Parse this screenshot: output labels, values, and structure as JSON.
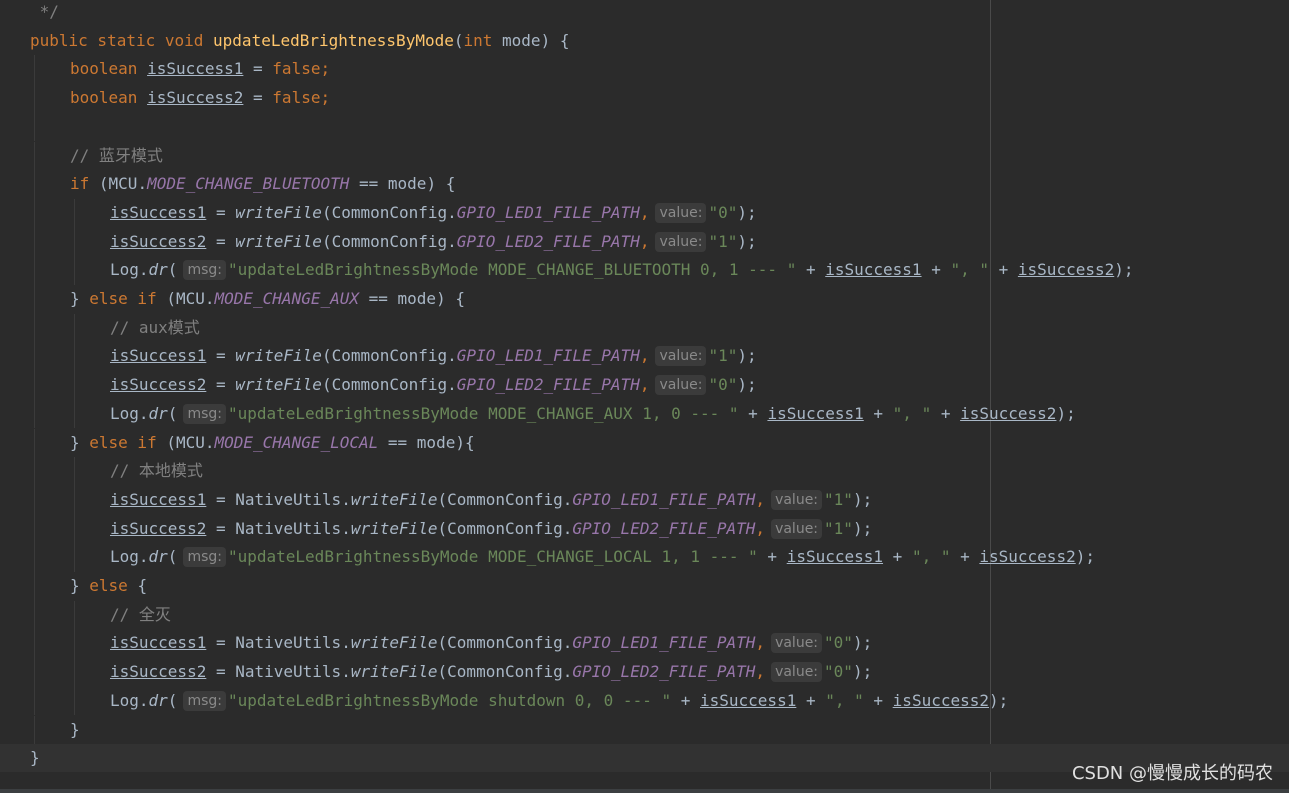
{
  "colors": {
    "background": "#2b2b2b",
    "keyword": "#cc7832",
    "method_declaration": "#ffc66d",
    "static_field": "#9876aa",
    "string": "#6a8759",
    "comment": "#808080",
    "default_text": "#a9b7c6",
    "inlay_hint_bg": "#3b3b3b"
  },
  "watermark": "CSDN @慢慢成长的码农",
  "code_lines": [
    {
      "indent": 0,
      "tokens": [
        {
          "t": " */",
          "c": "cmt"
        }
      ]
    },
    {
      "indent": 0,
      "tokens": [
        {
          "t": "public static void ",
          "c": "kw"
        },
        {
          "t": "updateLedBrightnessByMode",
          "c": "fn"
        },
        {
          "t": "(",
          "c": "t"
        },
        {
          "t": "int ",
          "c": "kw"
        },
        {
          "t": "mode) {",
          "c": "t"
        }
      ]
    },
    {
      "indent": 1,
      "tokens": [
        {
          "t": "boolean ",
          "c": "kw"
        },
        {
          "t": "isSuccess1",
          "c": "u"
        },
        {
          "t": " = ",
          "c": "t"
        },
        {
          "t": "false;",
          "c": "kw"
        }
      ]
    },
    {
      "indent": 1,
      "tokens": [
        {
          "t": "boolean ",
          "c": "kw"
        },
        {
          "t": "isSuccess2",
          "c": "u"
        },
        {
          "t": " = ",
          "c": "t"
        },
        {
          "t": "false;",
          "c": "kw"
        }
      ]
    },
    {
      "indent": 1,
      "tokens": []
    },
    {
      "indent": 1,
      "tokens": [
        {
          "t": "// 蓝牙模式",
          "c": "cmt"
        }
      ]
    },
    {
      "indent": 1,
      "tokens": [
        {
          "t": "if ",
          "c": "kw"
        },
        {
          "t": "(MCU.",
          "c": "t"
        },
        {
          "t": "MODE_CHANGE_BLUETOOTH",
          "c": "field"
        },
        {
          "t": " == mode) {",
          "c": "t"
        }
      ]
    },
    {
      "indent": 2,
      "tokens": [
        {
          "t": "isSuccess1",
          "c": "u"
        },
        {
          "t": " = ",
          "c": "t"
        },
        {
          "t": "writeFile",
          "c": "ital"
        },
        {
          "t": "(CommonConfig.",
          "c": "t"
        },
        {
          "t": "GPIO_LED1_FILE_PATH",
          "c": "field"
        },
        {
          "t": ",",
          "c": "kw"
        },
        {
          "t": "value:",
          "c": "hint"
        },
        {
          "t": "\"0\"",
          "c": "str"
        },
        {
          "t": ");",
          "c": "t"
        }
      ]
    },
    {
      "indent": 2,
      "tokens": [
        {
          "t": "isSuccess2",
          "c": "u"
        },
        {
          "t": " = ",
          "c": "t"
        },
        {
          "t": "writeFile",
          "c": "ital"
        },
        {
          "t": "(CommonConfig.",
          "c": "t"
        },
        {
          "t": "GPIO_LED2_FILE_PATH",
          "c": "field"
        },
        {
          "t": ",",
          "c": "kw"
        },
        {
          "t": "value:",
          "c": "hint"
        },
        {
          "t": "\"1\"",
          "c": "str"
        },
        {
          "t": ");",
          "c": "t"
        }
      ]
    },
    {
      "indent": 2,
      "tokens": [
        {
          "t": "Log.",
          "c": "t"
        },
        {
          "t": "dr",
          "c": "ital"
        },
        {
          "t": "(",
          "c": "t"
        },
        {
          "t": "msg:",
          "c": "hint"
        },
        {
          "t": "\"updateLedBrightnessByMode MODE_CHANGE_BLUETOOTH 0, 1 --- \"",
          "c": "str"
        },
        {
          "t": " + ",
          "c": "t"
        },
        {
          "t": "isSuccess1",
          "c": "u"
        },
        {
          "t": " + ",
          "c": "t"
        },
        {
          "t": "\", \"",
          "c": "str"
        },
        {
          "t": " + ",
          "c": "t"
        },
        {
          "t": "isSuccess2",
          "c": "u"
        },
        {
          "t": ");",
          "c": "t"
        }
      ]
    },
    {
      "indent": 1,
      "tokens": [
        {
          "t": "} ",
          "c": "t"
        },
        {
          "t": "else if ",
          "c": "kw"
        },
        {
          "t": "(MCU.",
          "c": "t"
        },
        {
          "t": "MODE_CHANGE_AUX",
          "c": "field"
        },
        {
          "t": " == mode) {",
          "c": "t"
        }
      ]
    },
    {
      "indent": 2,
      "tokens": [
        {
          "t": "// aux模式",
          "c": "cmt"
        }
      ]
    },
    {
      "indent": 2,
      "tokens": [
        {
          "t": "isSuccess1",
          "c": "u"
        },
        {
          "t": " = ",
          "c": "t"
        },
        {
          "t": "writeFile",
          "c": "ital"
        },
        {
          "t": "(CommonConfig.",
          "c": "t"
        },
        {
          "t": "GPIO_LED1_FILE_PATH",
          "c": "field"
        },
        {
          "t": ",",
          "c": "kw"
        },
        {
          "t": "value:",
          "c": "hint"
        },
        {
          "t": "\"1\"",
          "c": "str"
        },
        {
          "t": ");",
          "c": "t"
        }
      ]
    },
    {
      "indent": 2,
      "tokens": [
        {
          "t": "isSuccess2",
          "c": "u"
        },
        {
          "t": " = ",
          "c": "t"
        },
        {
          "t": "writeFile",
          "c": "ital"
        },
        {
          "t": "(CommonConfig.",
          "c": "t"
        },
        {
          "t": "GPIO_LED2_FILE_PATH",
          "c": "field"
        },
        {
          "t": ",",
          "c": "kw"
        },
        {
          "t": "value:",
          "c": "hint"
        },
        {
          "t": "\"0\"",
          "c": "str"
        },
        {
          "t": ");",
          "c": "t"
        }
      ]
    },
    {
      "indent": 2,
      "tokens": [
        {
          "t": "Log.",
          "c": "t"
        },
        {
          "t": "dr",
          "c": "ital"
        },
        {
          "t": "(",
          "c": "t"
        },
        {
          "t": "msg:",
          "c": "hint"
        },
        {
          "t": "\"updateLedBrightnessByMode MODE_CHANGE_AUX 1, 0 --- \"",
          "c": "str"
        },
        {
          "t": " + ",
          "c": "t"
        },
        {
          "t": "isSuccess1",
          "c": "u"
        },
        {
          "t": " + ",
          "c": "t"
        },
        {
          "t": "\", \"",
          "c": "str"
        },
        {
          "t": " + ",
          "c": "t"
        },
        {
          "t": "isSuccess2",
          "c": "u"
        },
        {
          "t": ");",
          "c": "t"
        }
      ]
    },
    {
      "indent": 1,
      "tokens": [
        {
          "t": "} ",
          "c": "t"
        },
        {
          "t": "else if ",
          "c": "kw"
        },
        {
          "t": "(MCU.",
          "c": "t"
        },
        {
          "t": "MODE_CHANGE_LOCAL",
          "c": "field"
        },
        {
          "t": " == mode){",
          "c": "t"
        }
      ]
    },
    {
      "indent": 2,
      "tokens": [
        {
          "t": "// 本地模式",
          "c": "cmt"
        }
      ]
    },
    {
      "indent": 2,
      "tokens": [
        {
          "t": "isSuccess1",
          "c": "u"
        },
        {
          "t": " = NativeUtils.",
          "c": "t"
        },
        {
          "t": "writeFile",
          "c": "ital"
        },
        {
          "t": "(CommonConfig.",
          "c": "t"
        },
        {
          "t": "GPIO_LED1_FILE_PATH",
          "c": "field"
        },
        {
          "t": ",",
          "c": "kw"
        },
        {
          "t": "value:",
          "c": "hint"
        },
        {
          "t": "\"1\"",
          "c": "str"
        },
        {
          "t": ");",
          "c": "t"
        }
      ]
    },
    {
      "indent": 2,
      "tokens": [
        {
          "t": "isSuccess2",
          "c": "u"
        },
        {
          "t": " = NativeUtils.",
          "c": "t"
        },
        {
          "t": "writeFile",
          "c": "ital"
        },
        {
          "t": "(CommonConfig.",
          "c": "t"
        },
        {
          "t": "GPIO_LED2_FILE_PATH",
          "c": "field"
        },
        {
          "t": ",",
          "c": "kw"
        },
        {
          "t": "value:",
          "c": "hint"
        },
        {
          "t": "\"1\"",
          "c": "str"
        },
        {
          "t": ");",
          "c": "t"
        }
      ]
    },
    {
      "indent": 2,
      "tokens": [
        {
          "t": "Log.",
          "c": "t"
        },
        {
          "t": "dr",
          "c": "ital"
        },
        {
          "t": "(",
          "c": "t"
        },
        {
          "t": "msg:",
          "c": "hint"
        },
        {
          "t": "\"updateLedBrightnessByMode MODE_CHANGE_LOCAL 1, 1 --- \"",
          "c": "str"
        },
        {
          "t": " + ",
          "c": "t"
        },
        {
          "t": "isSuccess1",
          "c": "u"
        },
        {
          "t": " + ",
          "c": "t"
        },
        {
          "t": "\", \"",
          "c": "str"
        },
        {
          "t": " + ",
          "c": "t"
        },
        {
          "t": "isSuccess2",
          "c": "u"
        },
        {
          "t": ");",
          "c": "t"
        }
      ]
    },
    {
      "indent": 1,
      "tokens": [
        {
          "t": "} ",
          "c": "t"
        },
        {
          "t": "else ",
          "c": "kw"
        },
        {
          "t": "{",
          "c": "t"
        }
      ]
    },
    {
      "indent": 2,
      "tokens": [
        {
          "t": "// 全灭",
          "c": "cmt"
        }
      ]
    },
    {
      "indent": 2,
      "tokens": [
        {
          "t": "isSuccess1",
          "c": "u"
        },
        {
          "t": " = NativeUtils.",
          "c": "t"
        },
        {
          "t": "writeFile",
          "c": "ital"
        },
        {
          "t": "(CommonConfig.",
          "c": "t"
        },
        {
          "t": "GPIO_LED1_FILE_PATH",
          "c": "field"
        },
        {
          "t": ",",
          "c": "kw"
        },
        {
          "t": "value:",
          "c": "hint"
        },
        {
          "t": "\"0\"",
          "c": "str"
        },
        {
          "t": ");",
          "c": "t"
        }
      ]
    },
    {
      "indent": 2,
      "tokens": [
        {
          "t": "isSuccess2",
          "c": "u"
        },
        {
          "t": " = NativeUtils.",
          "c": "t"
        },
        {
          "t": "writeFile",
          "c": "ital"
        },
        {
          "t": "(CommonConfig.",
          "c": "t"
        },
        {
          "t": "GPIO_LED2_FILE_PATH",
          "c": "field"
        },
        {
          "t": ",",
          "c": "kw"
        },
        {
          "t": "value:",
          "c": "hint"
        },
        {
          "t": "\"0\"",
          "c": "str"
        },
        {
          "t": ");",
          "c": "t"
        }
      ]
    },
    {
      "indent": 2,
      "tokens": [
        {
          "t": "Log.",
          "c": "t"
        },
        {
          "t": "dr",
          "c": "ital"
        },
        {
          "t": "(",
          "c": "t"
        },
        {
          "t": "msg:",
          "c": "hint"
        },
        {
          "t": "\"updateLedBrightnessByMode shutdown 0, 0 --- \"",
          "c": "str"
        },
        {
          "t": " + ",
          "c": "t"
        },
        {
          "t": "isSuccess1",
          "c": "u"
        },
        {
          "t": " + ",
          "c": "t"
        },
        {
          "t": "\", \"",
          "c": "str"
        },
        {
          "t": " + ",
          "c": "t"
        },
        {
          "t": "isSuccess2",
          "c": "u"
        },
        {
          "t": ");",
          "c": "t"
        }
      ]
    },
    {
      "indent": 1,
      "tokens": [
        {
          "t": "}",
          "c": "t"
        }
      ]
    },
    {
      "indent": 0,
      "tokens": [
        {
          "t": "}",
          "c": "t"
        }
      ],
      "current": true
    }
  ]
}
